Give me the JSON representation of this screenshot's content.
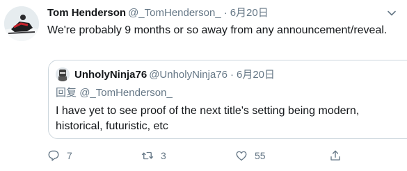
{
  "tweet": {
    "author_name": "Tom Henderson",
    "author_handle": "@_TomHenderson_",
    "separator": "·",
    "date": "6月20日",
    "text": "We're probably 9 months or so away from any announcement/reveal."
  },
  "quoted": {
    "author_name": "UnholyNinja76",
    "author_handle": "@UnholyNinja76",
    "separator": "·",
    "date": "6月20日",
    "reply_prefix": "回复",
    "reply_mention": "@_TomHenderson_",
    "text": "I have yet to see proof of the next title's setting being modern, historical, futuristic, etc"
  },
  "actions": {
    "reply_count": "7",
    "retweet_count": "3",
    "like_count": "55"
  },
  "icons": {
    "reply": "reply-icon",
    "retweet": "retweet-icon",
    "like": "heart-icon",
    "share": "share-icon",
    "caret": "chevron-down-icon"
  },
  "colors": {
    "secondary_text": "#657786",
    "border": "#ccd6dd"
  }
}
